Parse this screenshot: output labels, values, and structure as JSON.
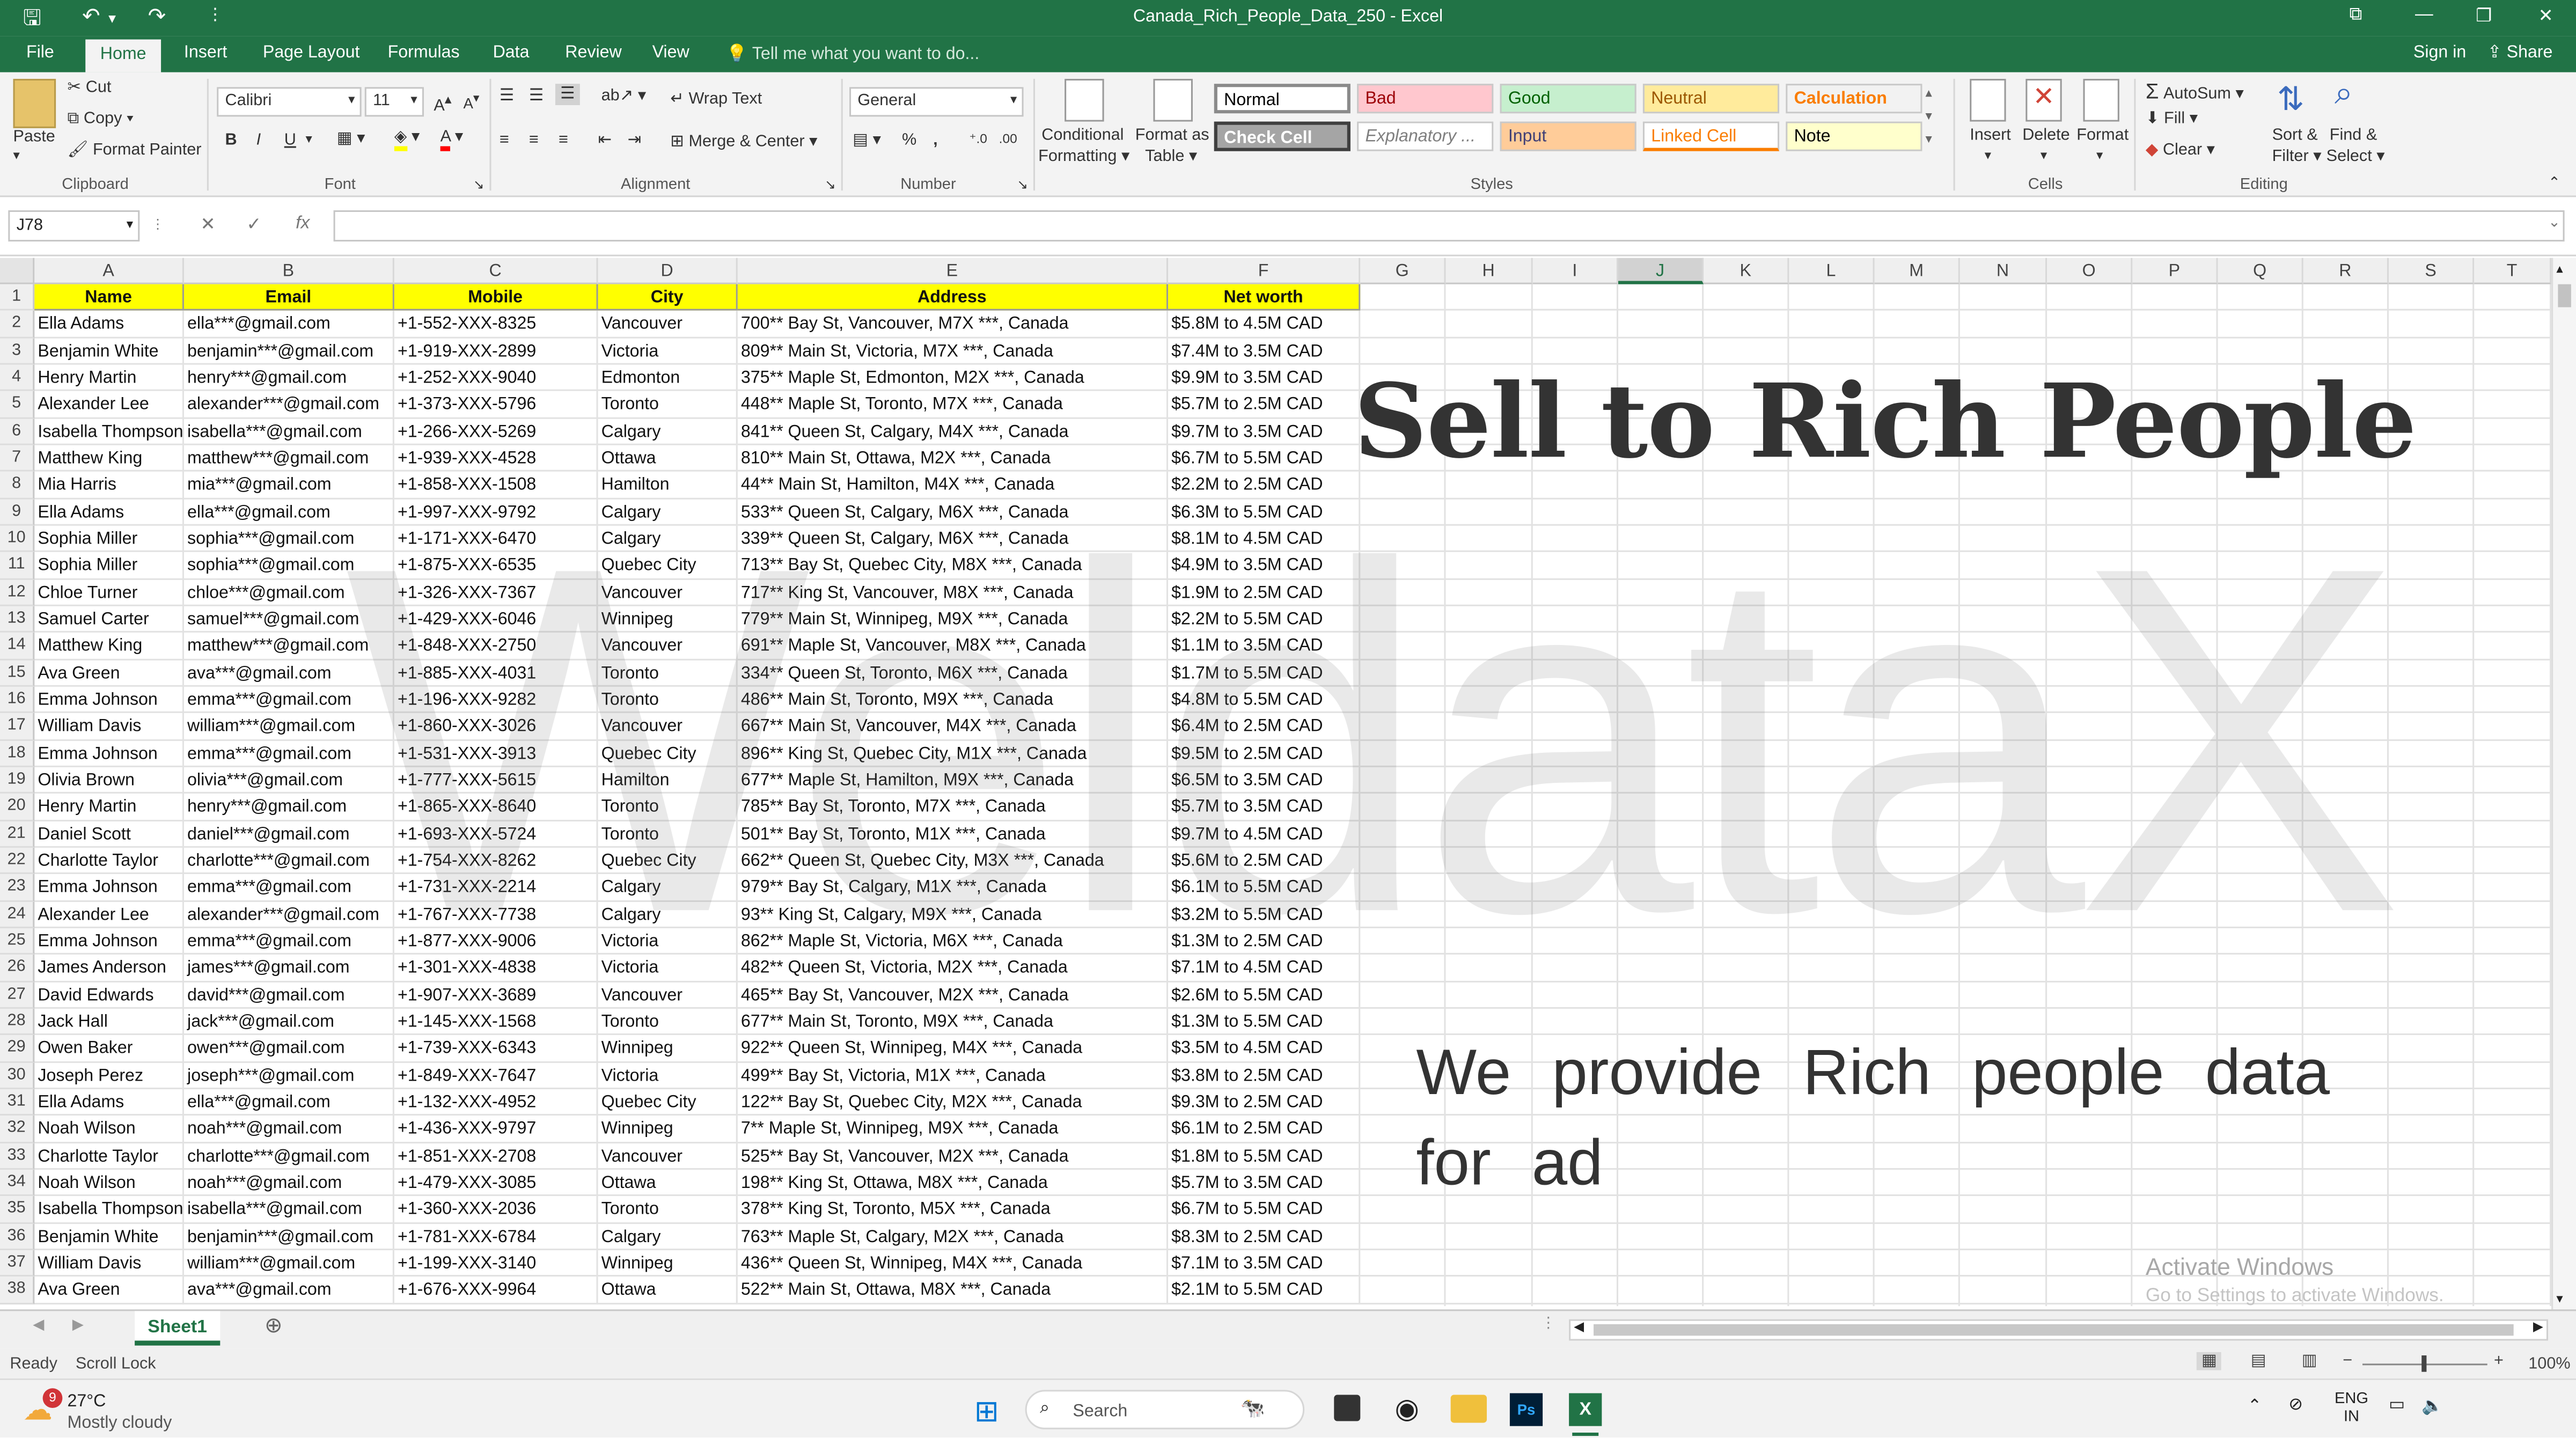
{
  "window": {
    "title": "Canada_Rich_People_Data_250 - Excel",
    "sign_in": "Sign in",
    "share": "Share"
  },
  "menu": {
    "tabs": [
      "File",
      "Home",
      "Insert",
      "Page Layout",
      "Formulas",
      "Data",
      "Review",
      "View"
    ],
    "active_tab": "Home",
    "tell_me": "Tell me what you want to do..."
  },
  "ribbon": {
    "clipboard": {
      "paste": "Paste",
      "cut": "Cut",
      "copy": "Copy",
      "format_painter": "Format Painter",
      "label": "Clipboard"
    },
    "font": {
      "name": "Calibri",
      "size": "11",
      "bold": "B",
      "italic": "I",
      "underline": "U",
      "label": "Font"
    },
    "alignment": {
      "wrap_text": "Wrap Text",
      "merge_center": "Merge & Center",
      "label": "Alignment"
    },
    "number": {
      "format": "General",
      "percent": "%",
      "label": "Number"
    },
    "styles": {
      "conditional": "Conditional",
      "formatting": "Formatting",
      "format_as": "Format as",
      "table": "Table",
      "cells": [
        {
          "name": "Normal",
          "bg": "#ffffff",
          "fg": "#000000"
        },
        {
          "name": "Bad",
          "bg": "#ffc7ce",
          "fg": "#9c0006"
        },
        {
          "name": "Good",
          "bg": "#c6efce",
          "fg": "#006100"
        },
        {
          "name": "Neutral",
          "bg": "#ffeb9c",
          "fg": "#9c5700"
        },
        {
          "name": "Calculation",
          "bg": "#f2f2f2",
          "fg": "#fa7d00"
        },
        {
          "name": "Check Cell",
          "bg": "#a5a5a5",
          "fg": "#ffffff"
        },
        {
          "name": "Explanatory ...",
          "bg": "#ffffff",
          "fg": "#7f7f7f"
        },
        {
          "name": "Input",
          "bg": "#ffcc99",
          "fg": "#3f3f76"
        },
        {
          "name": "Linked Cell",
          "bg": "#ffffff",
          "fg": "#fa7d00"
        },
        {
          "name": "Note",
          "bg": "#ffffcc",
          "fg": "#000000"
        }
      ],
      "label": "Styles"
    },
    "cells": {
      "insert": "Insert",
      "delete": "Delete",
      "format": "Format",
      "label": "Cells"
    },
    "editing": {
      "autosum": "AutoSum",
      "fill": "Fill",
      "clear": "Clear",
      "sort_filter_1": "Sort &",
      "sort_filter_2": "Filter",
      "find_select_1": "Find &",
      "find_select_2": "Select",
      "label": "Editing"
    }
  },
  "formula_bar": {
    "name_box": "J78",
    "fx": "fx",
    "value": ""
  },
  "grid": {
    "columns": [
      "A",
      "B",
      "C",
      "D",
      "E",
      "F",
      "G",
      "H",
      "I",
      "J",
      "K",
      "L",
      "M",
      "N",
      "O",
      "P",
      "Q",
      "R",
      "S",
      "T"
    ],
    "selected_column": "J",
    "header_row": [
      "Name",
      "Email",
      "Mobile",
      "City",
      "Address",
      "Net worth"
    ],
    "rows": [
      [
        "Ella Adams",
        "ella***@gmail.com",
        "+1-552-XXX-8325",
        "Vancouver",
        "700** Bay St, Vancouver, M7X ***, Canada",
        "$5.8M to 4.5M CAD"
      ],
      [
        "Benjamin White",
        "benjamin***@gmail.com",
        "+1-919-XXX-2899",
        "Victoria",
        "809** Main St, Victoria, M7X ***, Canada",
        "$7.4M to 3.5M CAD"
      ],
      [
        "Henry Martin",
        "henry***@gmail.com",
        "+1-252-XXX-9040",
        "Edmonton",
        "375** Maple St, Edmonton, M2X ***, Canada",
        "$9.9M to 3.5M CAD"
      ],
      [
        "Alexander Lee",
        "alexander***@gmail.com",
        "+1-373-XXX-5796",
        "Toronto",
        "448** Maple St, Toronto, M7X ***, Canada",
        "$5.7M to 2.5M CAD"
      ],
      [
        "Isabella Thompson",
        "isabella***@gmail.com",
        "+1-266-XXX-5269",
        "Calgary",
        "841** Queen St, Calgary, M4X ***, Canada",
        "$9.7M to 3.5M CAD"
      ],
      [
        "Matthew King",
        "matthew***@gmail.com",
        "+1-939-XXX-4528",
        "Ottawa",
        "810** Main St, Ottawa, M2X ***, Canada",
        "$6.7M to 5.5M CAD"
      ],
      [
        "Mia Harris",
        "mia***@gmail.com",
        "+1-858-XXX-1508",
        "Hamilton",
        "44** Main St, Hamilton, M4X ***, Canada",
        "$2.2M to 2.5M CAD"
      ],
      [
        "Ella Adams",
        "ella***@gmail.com",
        "+1-997-XXX-9792",
        "Calgary",
        "533** Queen St, Calgary, M6X ***, Canada",
        "$6.3M to 5.5M CAD"
      ],
      [
        "Sophia Miller",
        "sophia***@gmail.com",
        "+1-171-XXX-6470",
        "Calgary",
        "339** Queen St, Calgary, M6X ***, Canada",
        "$8.1M to 4.5M CAD"
      ],
      [
        "Sophia Miller",
        "sophia***@gmail.com",
        "+1-875-XXX-6535",
        "Quebec City",
        "713** Bay St, Quebec City, M8X ***, Canada",
        "$4.9M to 3.5M CAD"
      ],
      [
        "Chloe Turner",
        "chloe***@gmail.com",
        "+1-326-XXX-7367",
        "Vancouver",
        "717** King St, Vancouver, M8X ***, Canada",
        "$1.9M to 2.5M CAD"
      ],
      [
        "Samuel Carter",
        "samuel***@gmail.com",
        "+1-429-XXX-6046",
        "Winnipeg",
        "779** Main St, Winnipeg, M9X ***, Canada",
        "$2.2M to 5.5M CAD"
      ],
      [
        "Matthew King",
        "matthew***@gmail.com",
        "+1-848-XXX-2750",
        "Vancouver",
        "691** Maple St, Vancouver, M8X ***, Canada",
        "$1.1M to 3.5M CAD"
      ],
      [
        "Ava Green",
        "ava***@gmail.com",
        "+1-885-XXX-4031",
        "Toronto",
        "334** Queen St, Toronto, M6X ***, Canada",
        "$1.7M to 5.5M CAD"
      ],
      [
        "Emma Johnson",
        "emma***@gmail.com",
        "+1-196-XXX-9282",
        "Toronto",
        "486** Main St, Toronto, M9X ***, Canada",
        "$4.8M to 5.5M CAD"
      ],
      [
        "William Davis",
        "william***@gmail.com",
        "+1-860-XXX-3026",
        "Vancouver",
        "667** Main St, Vancouver, M4X ***, Canada",
        "$6.4M to 2.5M CAD"
      ],
      [
        "Emma Johnson",
        "emma***@gmail.com",
        "+1-531-XXX-3913",
        "Quebec City",
        "896** King St, Quebec City, M1X ***, Canada",
        "$9.5M to 2.5M CAD"
      ],
      [
        "Olivia Brown",
        "olivia***@gmail.com",
        "+1-777-XXX-5615",
        "Hamilton",
        "677** Maple St, Hamilton, M9X ***, Canada",
        "$6.5M to 3.5M CAD"
      ],
      [
        "Henry Martin",
        "henry***@gmail.com",
        "+1-865-XXX-8640",
        "Toronto",
        "785** Bay St, Toronto, M7X ***, Canada",
        "$5.7M to 3.5M CAD"
      ],
      [
        "Daniel Scott",
        "daniel***@gmail.com",
        "+1-693-XXX-5724",
        "Toronto",
        "501** Bay St, Toronto, M1X ***, Canada",
        "$9.7M to 4.5M CAD"
      ],
      [
        "Charlotte Taylor",
        "charlotte***@gmail.com",
        "+1-754-XXX-8262",
        "Quebec City",
        "662** Queen St, Quebec City, M3X ***, Canada",
        "$5.6M to 2.5M CAD"
      ],
      [
        "Emma Johnson",
        "emma***@gmail.com",
        "+1-731-XXX-2214",
        "Calgary",
        "979** Bay St, Calgary, M1X ***, Canada",
        "$6.1M to 5.5M CAD"
      ],
      [
        "Alexander Lee",
        "alexander***@gmail.com",
        "+1-767-XXX-7738",
        "Calgary",
        "93** King St, Calgary, M9X ***, Canada",
        "$3.2M to 5.5M CAD"
      ],
      [
        "Emma Johnson",
        "emma***@gmail.com",
        "+1-877-XXX-9006",
        "Victoria",
        "862** Maple St, Victoria, M6X ***, Canada",
        "$1.3M to 2.5M CAD"
      ],
      [
        "James Anderson",
        "james***@gmail.com",
        "+1-301-XXX-4838",
        "Victoria",
        "482** Queen St, Victoria, M2X ***, Canada",
        "$7.1M to 4.5M CAD"
      ],
      [
        "David Edwards",
        "david***@gmail.com",
        "+1-907-XXX-3689",
        "Vancouver",
        "465** Bay St, Vancouver, M2X ***, Canada",
        "$2.6M to 5.5M CAD"
      ],
      [
        "Jack Hall",
        "jack***@gmail.com",
        "+1-145-XXX-1568",
        "Toronto",
        "677** Main St, Toronto, M9X ***, Canada",
        "$1.3M to 5.5M CAD"
      ],
      [
        "Owen Baker",
        "owen***@gmail.com",
        "+1-739-XXX-6343",
        "Winnipeg",
        "922** Queen St, Winnipeg, M4X ***, Canada",
        "$3.5M to 4.5M CAD"
      ],
      [
        "Joseph Perez",
        "joseph***@gmail.com",
        "+1-849-XXX-7647",
        "Victoria",
        "499** Bay St, Victoria, M1X ***, Canada",
        "$3.8M to 2.5M CAD"
      ],
      [
        "Ella Adams",
        "ella***@gmail.com",
        "+1-132-XXX-4952",
        "Quebec City",
        "122** Bay St, Quebec City, M2X ***, Canada",
        "$9.3M to 2.5M CAD"
      ],
      [
        "Noah Wilson",
        "noah***@gmail.com",
        "+1-436-XXX-9797",
        "Winnipeg",
        "7** Maple St, Winnipeg, M9X ***, Canada",
        "$6.1M to 2.5M CAD"
      ],
      [
        "Charlotte Taylor",
        "charlotte***@gmail.com",
        "+1-851-XXX-2708",
        "Vancouver",
        "525** Bay St, Vancouver, M2X ***, Canada",
        "$1.8M to 5.5M CAD"
      ],
      [
        "Noah Wilson",
        "noah***@gmail.com",
        "+1-479-XXX-3085",
        "Ottawa",
        "198** King St, Ottawa, M8X ***, Canada",
        "$5.7M to 3.5M CAD"
      ],
      [
        "Isabella Thompson",
        "isabella***@gmail.com",
        "+1-360-XXX-2036",
        "Toronto",
        "378** King St, Toronto, M5X ***, Canada",
        "$6.7M to 5.5M CAD"
      ],
      [
        "Benjamin White",
        "benjamin***@gmail.com",
        "+1-781-XXX-6784",
        "Calgary",
        "763** Maple St, Calgary, M2X ***, Canada",
        "$8.3M to 2.5M CAD"
      ],
      [
        "William Davis",
        "william***@gmail.com",
        "+1-199-XXX-3140",
        "Winnipeg",
        "436** Queen St, Winnipeg, M4X ***, Canada",
        "$7.1M to 3.5M CAD"
      ],
      [
        "Ava Green",
        "ava***@gmail.com",
        "+1-676-XXX-9964",
        "Ottawa",
        "522** Main St, Ottawa, M8X ***, Canada",
        "$2.1M to 5.5M CAD"
      ]
    ]
  },
  "overlay": {
    "headline": "Sell to Rich People",
    "subline": "We provide Rich people data for ad",
    "watermark": "WeldataX"
  },
  "activation": {
    "title": "Activate Windows",
    "body": "Go to Settings to activate Windows."
  },
  "sheets": {
    "active": "Sheet1"
  },
  "status": {
    "ready": "Ready",
    "scroll_lock": "Scroll Lock",
    "zoom": "100%"
  },
  "taskbar": {
    "weather_badge": "9",
    "temp": "27°C",
    "condition": "Mostly cloudy",
    "search": "Search",
    "lang_1": "ENG",
    "lang_2": "IN"
  }
}
